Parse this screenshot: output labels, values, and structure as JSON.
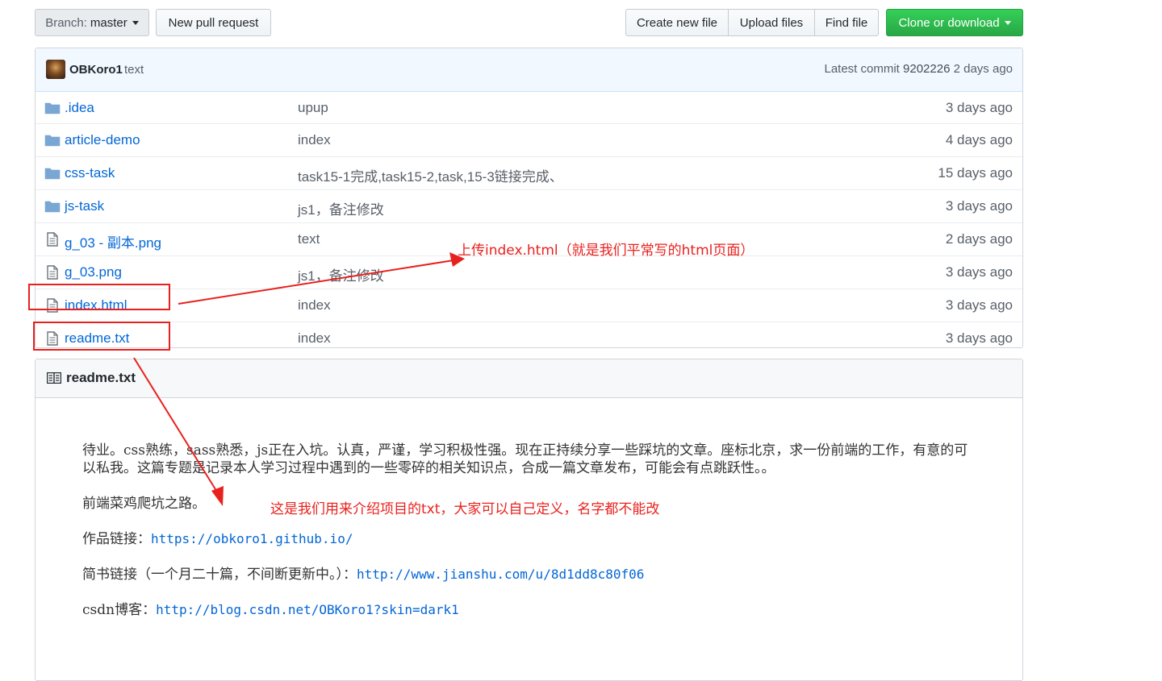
{
  "toolbar": {
    "branch_prefix": "Branch:",
    "branch_name": "master",
    "new_pull_request": "New pull request",
    "create_new_file": "Create new file",
    "upload_files": "Upload files",
    "find_file": "Find file",
    "clone_or_download": "Clone or download"
  },
  "commit": {
    "author": "OBKoro1",
    "message": "text",
    "latest_label": "Latest commit",
    "sha": "9202226",
    "age": "2 days ago"
  },
  "files": [
    {
      "type": "folder",
      "name": ".idea",
      "message": "upup",
      "age": "3 days ago"
    },
    {
      "type": "folder",
      "name": "article-demo",
      "message": "index",
      "age": "4 days ago"
    },
    {
      "type": "folder",
      "name": "css-task",
      "message": "task15-1完成,task15-2,task,15-3链接完成、",
      "age": "15 days ago"
    },
    {
      "type": "folder",
      "name": "js-task",
      "message": "js1，备注修改",
      "age": "3 days ago"
    },
    {
      "type": "file",
      "name": "g_03 - 副本.png",
      "message": "text",
      "age": "2 days ago"
    },
    {
      "type": "file",
      "name": "g_03.png",
      "message": "js1，备注修改",
      "age": "3 days ago"
    },
    {
      "type": "file",
      "name": "index.html",
      "message": "index",
      "age": "3 days ago"
    },
    {
      "type": "file",
      "name": "readme.txt",
      "message": "index",
      "age": "3 days ago"
    }
  ],
  "readme": {
    "title": "readme.txt",
    "para1": "待业。css熟练，sass熟悉，js正在入坑。认真，严谨，学习积极性强。现在正持续分享一些踩坑的文章。座标北京，求一份前端的工作，有意的可以私我。这篇专题是记录本人学习过程中遇到的一些零碎的相关知识点，合成一篇文章发布，可能会有点跳跃性。。",
    "para2": "前端菜鸡爬坑之路。",
    "works_label": "作品链接：",
    "works_url": "https://obkoro1.github.io/",
    "jianshu_label": "简书链接（一个月二十篇，不间断更新中。）：",
    "jianshu_url": "http://www.jianshu.com/u/8d1dd8c80f06",
    "csdn_label": "csdn博客：",
    "csdn_url": "http://blog.csdn.net/OBKoro1?skin=dark1"
  },
  "annotations": {
    "upload_note": "上传index.html（就是我们平常写的html页面）",
    "readme_note": "这是我们用来介绍项目的txt，大家可以自己定义，名字都不能改",
    "color": "#e8211e"
  }
}
